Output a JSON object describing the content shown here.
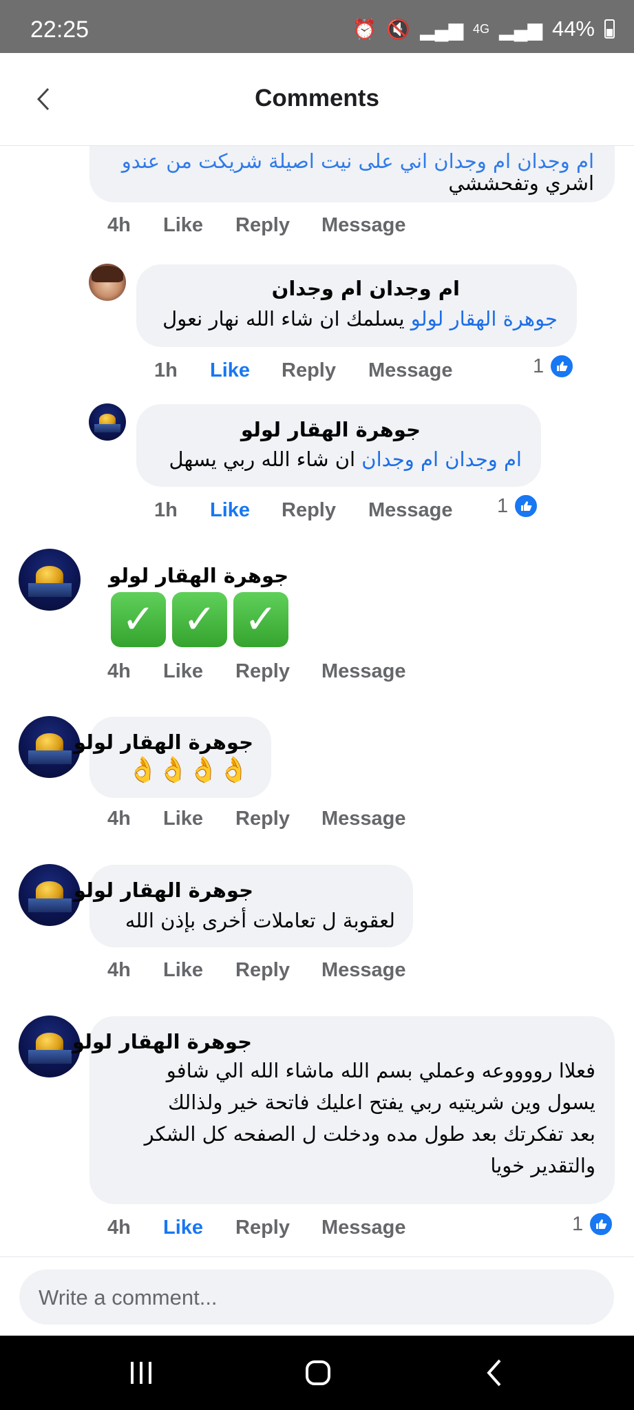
{
  "status": {
    "time": "22:25",
    "battery": "44%",
    "network": "4G"
  },
  "header": {
    "title": "Comments"
  },
  "comments": [
    {
      "partial_text": "ام وجدان ام وجدان اني على نيت اصيلة شريكت من عندو",
      "lines": [
        "اشري وتفحششي"
      ],
      "time": "4h",
      "like": "Like",
      "reply": "Reply",
      "message": "Message"
    },
    {
      "author": "ام وجدان ام وجدان",
      "mention": "جوهرة الهقار لولو",
      "text": " يسلمك ان شاء الله نهار نعول",
      "time": "1h",
      "like": "Like",
      "reply": "Reply",
      "message": "Message",
      "reactions": "1"
    },
    {
      "author": "جوهرة الهقار لولو",
      "mention": "ام وجدان ام وجدان",
      "text": " ان شاء الله ربي يسهل",
      "time": "1h",
      "like": "Like",
      "reply": "Reply",
      "message": "Message",
      "reactions": "1"
    },
    {
      "author": "جوهرة الهقار لولو",
      "emoji": "✓",
      "time": "4h",
      "like": "Like",
      "reply": "Reply",
      "message": "Message"
    },
    {
      "author": "جوهرة الهقار لولو",
      "emoji": "👌",
      "time": "4h",
      "like": "Like",
      "reply": "Reply",
      "message": "Message"
    },
    {
      "author": "جوهرة الهقار لولو",
      "text": "لعقوبة ل تعاملات أخرى بإذن الله",
      "time": "4h",
      "like": "Like",
      "reply": "Reply",
      "message": "Message"
    },
    {
      "author": "جوهرة الهقار لولو",
      "lines": [
        "فعلاا رووووعه وعملي بسم الله ماشاء الله الي شافو",
        "يسول وين شريتيه ربي يفتح اعليك فاتحة خير ولذالك",
        "بعد تفكرتك بعد طول مده ودخلت ل الصفحه كل الشكر",
        "والتقدير خويا"
      ],
      "time": "4h",
      "like": "Like",
      "reply": "Reply",
      "message": "Message",
      "reactions": "1"
    }
  ],
  "composer": {
    "placeholder": "Write a comment..."
  }
}
